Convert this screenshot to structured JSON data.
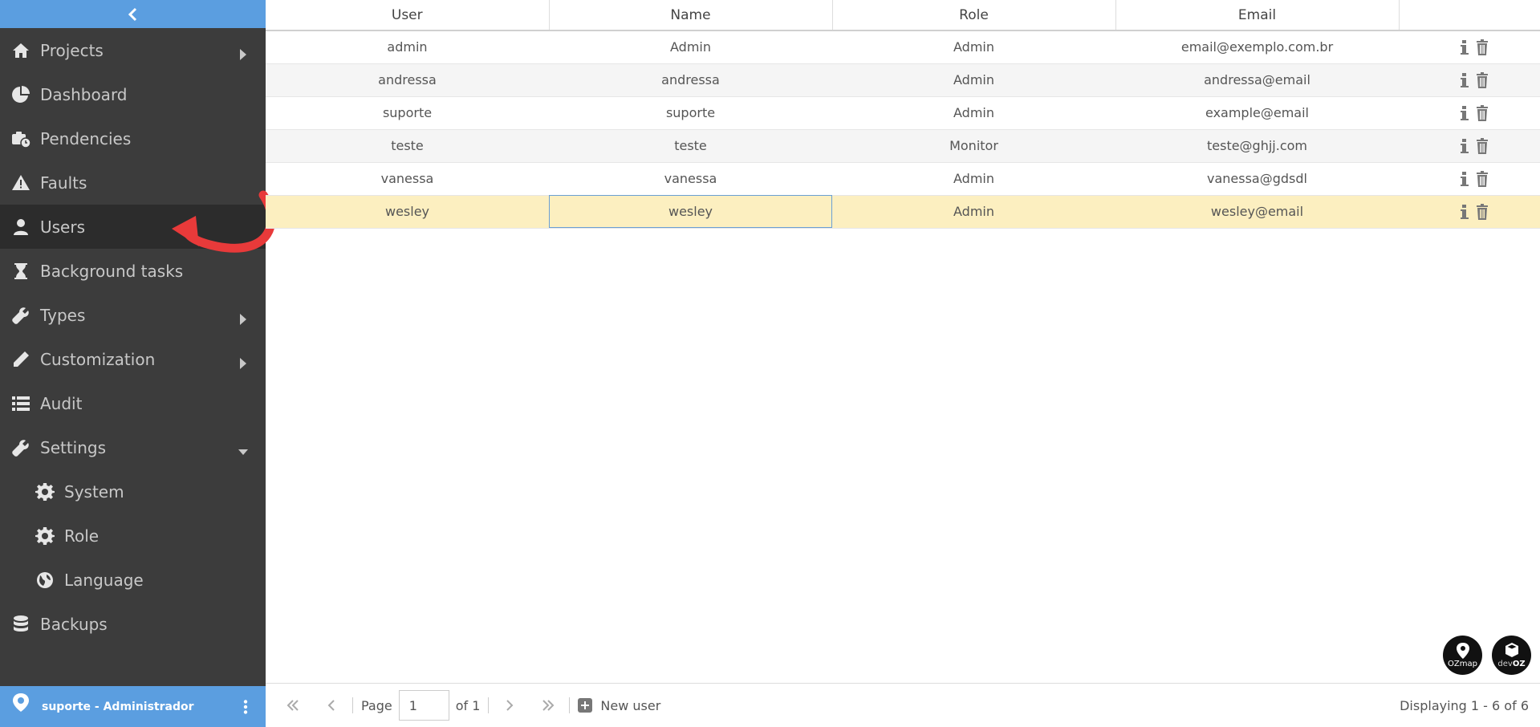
{
  "sidebar": {
    "items": [
      {
        "label": "Projects",
        "icon": "home-icon"
      },
      {
        "label": "Dashboard",
        "icon": "pie-chart-icon"
      },
      {
        "label": "Pendencies",
        "icon": "briefcase-clock-icon"
      },
      {
        "label": "Faults",
        "icon": "warning-icon"
      },
      {
        "label": "Users",
        "icon": "user-icon"
      },
      {
        "label": "Background tasks",
        "icon": "hourglass-icon"
      },
      {
        "label": "Types",
        "icon": "wrench-icon"
      },
      {
        "label": "Customization",
        "icon": "pencil-icon"
      },
      {
        "label": "Audit",
        "icon": "list-icon"
      },
      {
        "label": "Settings",
        "icon": "wrench-icon"
      },
      {
        "label": "System",
        "icon": "gear-icon"
      },
      {
        "label": "Role",
        "icon": "gear-icon"
      },
      {
        "label": "Language",
        "icon": "globe-icon"
      },
      {
        "label": "Backups",
        "icon": "database-icon"
      }
    ],
    "footer": {
      "user_label": "suporte - Administrador",
      "logo_text": "OZmap"
    }
  },
  "table": {
    "headers": [
      "User",
      "Name",
      "Role",
      "Email"
    ],
    "rows": [
      {
        "user": "admin",
        "name": "Admin",
        "role": "Admin",
        "email": "email@exemplo.com.br"
      },
      {
        "user": "andressa",
        "name": "andressa",
        "role": "Admin",
        "email": "andressa@email"
      },
      {
        "user": "suporte",
        "name": "suporte",
        "role": "Admin",
        "email": "example@email"
      },
      {
        "user": "teste",
        "name": "teste",
        "role": "Monitor",
        "email": "teste@ghjj.com"
      },
      {
        "user": "vanessa",
        "name": "vanessa",
        "role": "Admin",
        "email": "vanessa@gdsdl"
      },
      {
        "user": "wesley",
        "name": "wesley",
        "role": "Admin",
        "email": "wesley@email"
      }
    ]
  },
  "toolbar": {
    "page_label": "Page",
    "page_value": "1",
    "of_label": "of 1",
    "new_user_label": "New user",
    "display_info": "Displaying 1 - 6 of 6"
  },
  "badges": {
    "ozmap": "OZmap",
    "devoz_top": "dev",
    "devoz_bottom": "OZ"
  },
  "colors": {
    "sidebar_bg": "#3c3c3c",
    "accent": "#5b9ee0",
    "selected_row": "#fcefc0",
    "arrow": "#e83a3a"
  }
}
